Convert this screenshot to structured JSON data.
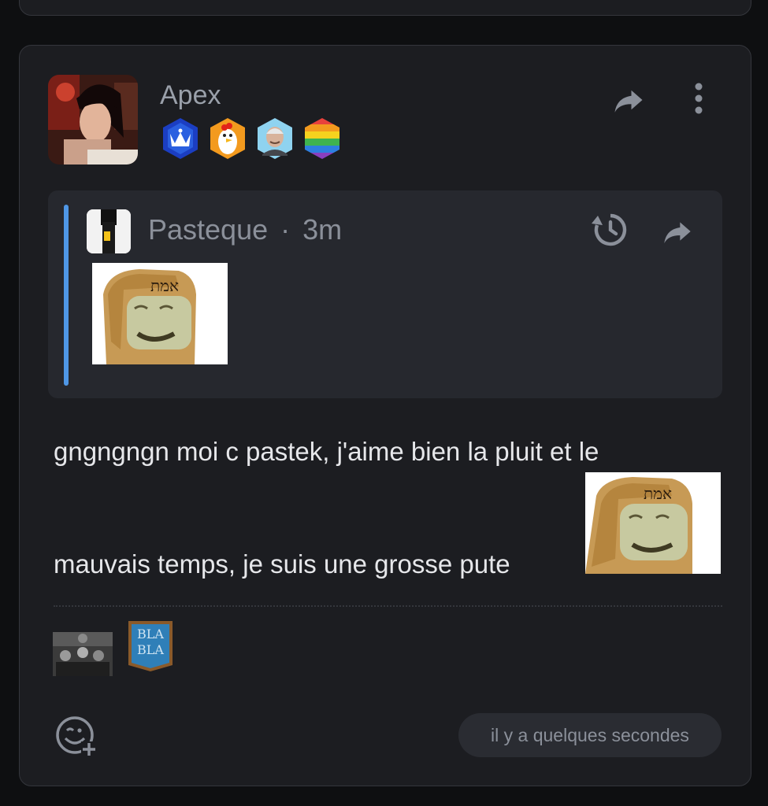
{
  "post": {
    "author": "Apex",
    "badges": [
      {
        "icon": "crown-badge-icon",
        "color": "#1b3ec2"
      },
      {
        "icon": "chicken-badge-icon",
        "color": "#f39a1e"
      },
      {
        "icon": "smiling-man-badge-icon",
        "color": "#8fd3f0"
      },
      {
        "icon": "rainbow-badge-icon",
        "color": "#e8413c"
      }
    ],
    "text_line1": "gngngngn moi c pastek, j'aime bien la pluit et le",
    "text_line2": "mauvais temps, je suis une grosse pute",
    "inline_sticker_label": "אמת",
    "timestamp": "il y a quelques secondes"
  },
  "quote": {
    "author": "Pasteque",
    "separator": "·",
    "age": "3m",
    "image_label": "אמת"
  },
  "reactions": {
    "sticker_bla": "BLA",
    "sticker_bla2": "BLA"
  },
  "colors": {
    "accent_bar": "#4f97e6",
    "card_bg": "#1c1d21",
    "quote_bg": "#26282e"
  }
}
